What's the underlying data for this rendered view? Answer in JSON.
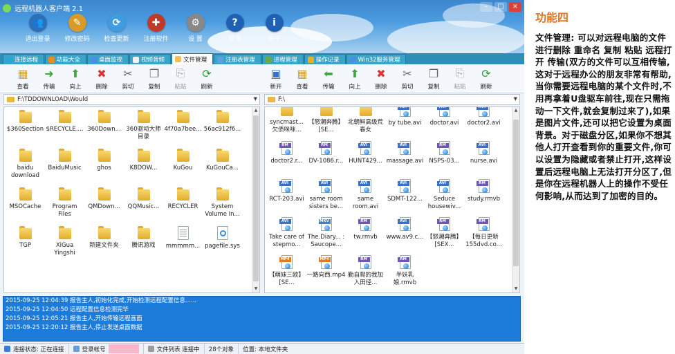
{
  "app": {
    "title": "远程机器人客户端 2.1"
  },
  "top_toolbar": [
    {
      "label": "退出登录",
      "icon": "user-group-icon",
      "color": "#2d6fb8"
    },
    {
      "label": "修改密码",
      "icon": "key-icon",
      "color": "#d89b2a"
    },
    {
      "label": "检查更新",
      "icon": "globe-update-icon",
      "color": "#3e9de0"
    },
    {
      "label": "注册软件",
      "icon": "register-icon",
      "color": "#c0392b"
    },
    {
      "label": "设 置",
      "icon": "gear-icon",
      "color": "#888888"
    },
    {
      "label": "帮 助",
      "icon": "help-icon",
      "color": "#1f62b3"
    },
    {
      "label": "关于",
      "icon": "info-icon",
      "color": "#1f62b3"
    }
  ],
  "tabs": [
    {
      "label": "连接远程",
      "color": "#2aa5d6"
    },
    {
      "label": "功能大全",
      "color": "#e58e26"
    },
    {
      "label": "桌面监视",
      "color": "#4a90e2"
    },
    {
      "label": "视频音频",
      "color": "#f0f0f0"
    },
    {
      "label": "文件管理",
      "color": "#f2c14e",
      "active": true
    },
    {
      "label": "注册表管理",
      "color": "#5aa1e0"
    },
    {
      "label": "进程管理",
      "color": "#6aa84f"
    },
    {
      "label": "操作记录",
      "color": "#e2b22a"
    },
    {
      "label": "Win32服务管理",
      "color": "#4a90e2"
    }
  ],
  "left_toolbar": [
    {
      "label": "查看",
      "icon": "view-icon"
    },
    {
      "label": "传输",
      "icon": "transfer-right-icon"
    },
    {
      "label": "向上",
      "icon": "up-arrow-icon"
    },
    {
      "label": "删除",
      "icon": "delete-icon"
    },
    {
      "label": "剪切",
      "icon": "cut-icon"
    },
    {
      "label": "复制",
      "icon": "copy-icon"
    },
    {
      "label": "粘贴",
      "icon": "paste-icon",
      "disabled": true
    },
    {
      "label": "刷新",
      "icon": "refresh-icon"
    }
  ],
  "right_toolbar": [
    {
      "label": "新开",
      "icon": "new-open-icon"
    },
    {
      "label": "查看",
      "icon": "view-icon"
    },
    {
      "label": "传输",
      "icon": "transfer-left-icon"
    },
    {
      "label": "向上",
      "icon": "up-arrow-icon"
    },
    {
      "label": "删除",
      "icon": "delete-icon"
    },
    {
      "label": "剪切",
      "icon": "cut-icon"
    },
    {
      "label": "复制",
      "icon": "copy-icon"
    },
    {
      "label": "粘贴",
      "icon": "paste-icon",
      "disabled": true
    },
    {
      "label": "刷新",
      "icon": "refresh-icon"
    }
  ],
  "left_path": "F:\\TDDOWNLOAD\\Would",
  "right_path": "F:\\",
  "left_files": [
    {
      "name": "$360Section",
      "type": "folder"
    },
    {
      "name": "$RECYCLE....",
      "type": "folder"
    },
    {
      "name": "360Down...",
      "type": "folder"
    },
    {
      "name": "360驱动大师目录",
      "type": "folder"
    },
    {
      "name": "4f70a7bee...",
      "type": "folder"
    },
    {
      "name": "56ac912f6...",
      "type": "folder"
    },
    {
      "name": "baidu download",
      "type": "folder"
    },
    {
      "name": "BaiduMusic",
      "type": "folder"
    },
    {
      "name": "ghos",
      "type": "folder"
    },
    {
      "name": "K8DOW...",
      "type": "folder"
    },
    {
      "name": "KuGou",
      "type": "folder"
    },
    {
      "name": "KuGouCa...",
      "type": "folder"
    },
    {
      "name": "MSOCache",
      "type": "folder"
    },
    {
      "name": "Program Files",
      "type": "folder"
    },
    {
      "name": "QMDown...",
      "type": "folder"
    },
    {
      "name": "QQMusic...",
      "type": "folder"
    },
    {
      "name": "RECYCLER",
      "type": "folder"
    },
    {
      "name": "System Volume In...",
      "type": "folder"
    },
    {
      "name": "TGP",
      "type": "folder"
    },
    {
      "name": "XiGua Yingshi",
      "type": "folder"
    },
    {
      "name": "新建文件夹",
      "type": "folder"
    },
    {
      "name": "腾讯游戏",
      "type": "folder"
    },
    {
      "name": "mmmmm...",
      "type": "doc"
    },
    {
      "name": "pagefile.sys",
      "type": "sys"
    }
  ],
  "right_files": [
    {
      "name": "syncmast... 欠债咪咪...",
      "type": "folder"
    },
    {
      "name": "【怒潮奔腾】[SE...",
      "type": "folder"
    },
    {
      "name": "北朝鲜高级荒春女",
      "type": "folder"
    },
    {
      "name": "by tube.avi",
      "type": "avi"
    },
    {
      "name": "doctor.avi",
      "type": "avi"
    },
    {
      "name": "doctor2.avi",
      "type": "avi"
    },
    {
      "name": "doctor2.r...",
      "type": "rmvb"
    },
    {
      "name": "DV-1086.r...",
      "type": "rmvb"
    },
    {
      "name": "HUNT429...",
      "type": "avi"
    },
    {
      "name": "massage.avi",
      "type": "avi"
    },
    {
      "name": "NSPS-03...",
      "type": "rmvb"
    },
    {
      "name": "nurse.avi",
      "type": "avi"
    },
    {
      "name": "RCT-203.avi",
      "type": "avi"
    },
    {
      "name": "same room sisters be...",
      "type": "avi"
    },
    {
      "name": "same room.avi",
      "type": "avi"
    },
    {
      "name": "SDMT-122...",
      "type": "avi"
    },
    {
      "name": "Seduce housewiv...",
      "type": "avi"
    },
    {
      "name": "study.rmvb",
      "type": "rmvb"
    },
    {
      "name": "Take care of stepmo...",
      "type": "avi"
    },
    {
      "name": "The.Diary... : Saucope...",
      "type": "mkv"
    },
    {
      "name": "tw.rmvb",
      "type": "rmvb"
    },
    {
      "name": "www.av9.c...",
      "type": "avi"
    },
    {
      "name": "【怒潮奔腾】[SEX...",
      "type": "rmvb"
    },
    {
      "name": "【每日更新155dvd.co...",
      "type": "rmvb"
    },
    {
      "name": "【萌妹三欧】[SE...",
      "type": "mp4"
    },
    {
      "name": "一路向西.mp4",
      "type": "mp4"
    },
    {
      "name": "勤自爬的我加入田径...",
      "type": "rmvb"
    },
    {
      "name": "半妖乳娘.rmvb",
      "type": "rmvb"
    }
  ],
  "type_labels": {
    "avi": "AVI",
    "rmvb": "RM",
    "mkv": "MKV",
    "mp4": "MP4"
  },
  "type_colors": {
    "avi": "#3a6fc9",
    "rmvb": "#6d56b5",
    "mkv": "#3f7ec5",
    "mp4": "#e07b24"
  },
  "log": [
    "2015-09-25 12:04:39 报告主人,初始化完成,开始检测远程配置信息......",
    "2015-09-25 12:04:50 远程配置信息检测完毕",
    "2015-09-25 12:05:21 报告主人,开始传输远程画面",
    "2015-09-25 12:20:12 报告主人,停止发送桌面数据"
  ],
  "status": {
    "connection": "连接状态: 正在连接",
    "login": "登录帐号",
    "file_list": "文件列表 连接中",
    "count": "28个对象",
    "location": "位置: 本地文件夹"
  },
  "side": {
    "heading": "功能四",
    "body": "文件管理: 可以对远程电脑的文件进行删除 重命名 复制 粘贴 远程打开 传输(双方的文件可以互相传输,这对于远程办公的朋友非常有帮助,当你需要远程电脑的某个文件时,不用再拿着U盘驱车前往,现在只需拖动一下文件,就会复制过来了),如果是图片文件,还可以把它设置为桌面背景。对于磁盘分区,如果你不想其他人打开查看到你的重要文件,你可以设置为隐藏或者禁止打开,这样设置后远程电脑上无法打开分区了,但是你在远程机器人上的操作不受任何影响,从而达到了加密的目的。"
  }
}
